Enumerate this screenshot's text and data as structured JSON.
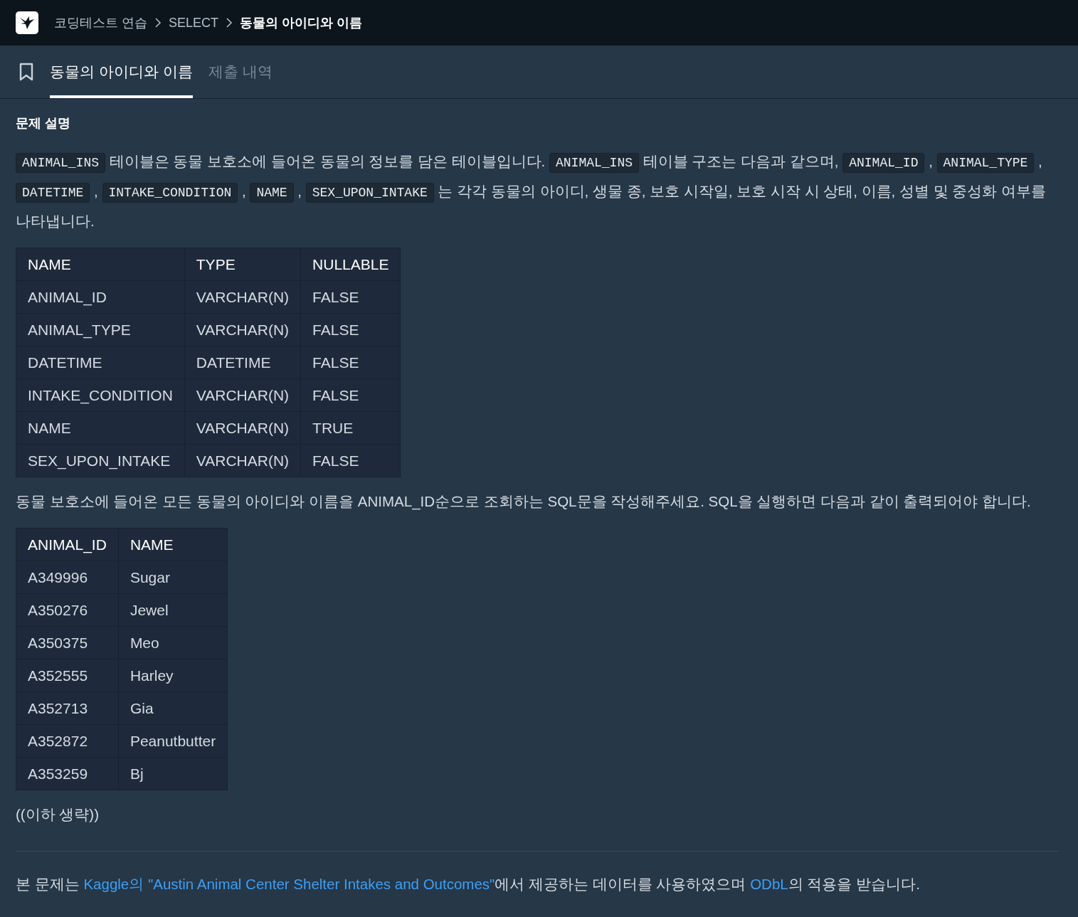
{
  "breadcrumb": [
    {
      "label": "코딩테스트 연습",
      "current": false
    },
    {
      "label": "SELECT",
      "current": false
    },
    {
      "label": "동물의 아이디와 이름",
      "current": true
    }
  ],
  "tabs": [
    {
      "label": "동물의 아이디와 이름",
      "selected": true
    },
    {
      "label": "제출 내역",
      "selected": false
    }
  ],
  "section_title": "문제 설명",
  "intro": [
    {
      "kind": "code",
      "text": "ANIMAL_INS"
    },
    {
      "kind": "text",
      "text": " 테이블은 동물 보호소에 들어온 동물의 정보를 담은 테이블입니다. "
    },
    {
      "kind": "code",
      "text": "ANIMAL_INS"
    },
    {
      "kind": "text",
      "text": " 테이블 구조는 다음과 같으며, "
    },
    {
      "kind": "code",
      "text": "ANIMAL_ID"
    },
    {
      "kind": "text",
      "text": " , "
    },
    {
      "kind": "code",
      "text": "ANIMAL_TYPE"
    },
    {
      "kind": "text",
      "text": " , "
    },
    {
      "kind": "code",
      "text": "DATETIME"
    },
    {
      "kind": "text",
      "text": " , "
    },
    {
      "kind": "code",
      "text": "INTAKE_CONDITION"
    },
    {
      "kind": "text",
      "text": " , "
    },
    {
      "kind": "code",
      "text": "NAME"
    },
    {
      "kind": "text",
      "text": " , "
    },
    {
      "kind": "code",
      "text": "SEX_UPON_INTAKE"
    },
    {
      "kind": "text",
      "text": " 는 각각 동물의 아이디, 생물 종, 보호 시작일, 보호 시작 시 상태, 이름, 성별 및 중성화 여부를 나타냅니다."
    }
  ],
  "schema_table": {
    "columns": [
      "NAME",
      "TYPE",
      "NULLABLE"
    ],
    "rows": [
      [
        "ANIMAL_ID",
        "VARCHAR(N)",
        "FALSE"
      ],
      [
        "ANIMAL_TYPE",
        "VARCHAR(N)",
        "FALSE"
      ],
      [
        "DATETIME",
        "DATETIME",
        "FALSE"
      ],
      [
        "INTAKE_CONDITION",
        "VARCHAR(N)",
        "FALSE"
      ],
      [
        "NAME",
        "VARCHAR(N)",
        "TRUE"
      ],
      [
        "SEX_UPON_INTAKE",
        "VARCHAR(N)",
        "FALSE"
      ]
    ]
  },
  "task": "동물 보호소에 들어온 모든 동물의 아이디와 이름을 ANIMAL_ID순으로 조회하는 SQL문을 작성해주세요. SQL을 실행하면 다음과 같이 출력되어야 합니다.",
  "result_table": {
    "columns": [
      "ANIMAL_ID",
      "NAME"
    ],
    "rows": [
      [
        "A349996",
        "Sugar"
      ],
      [
        "A350276",
        "Jewel"
      ],
      [
        "A350375",
        "Meo"
      ],
      [
        "A352555",
        "Harley"
      ],
      [
        "A352713",
        "Gia"
      ],
      [
        "A352872",
        "Peanutbutter"
      ],
      [
        "A353259",
        "Bj"
      ]
    ]
  },
  "omitted": "((이하 생략))",
  "footer": [
    {
      "kind": "text",
      "text": "본 문제는 "
    },
    {
      "kind": "link",
      "text": "Kaggle의 \"Austin Animal Center Shelter Intakes and Outcomes\""
    },
    {
      "kind": "text",
      "text": "에서 제공하는 데이터를 사용하였으며 "
    },
    {
      "kind": "link",
      "text": "ODbL"
    },
    {
      "kind": "text",
      "text": "의 적용을 받습니다."
    }
  ]
}
